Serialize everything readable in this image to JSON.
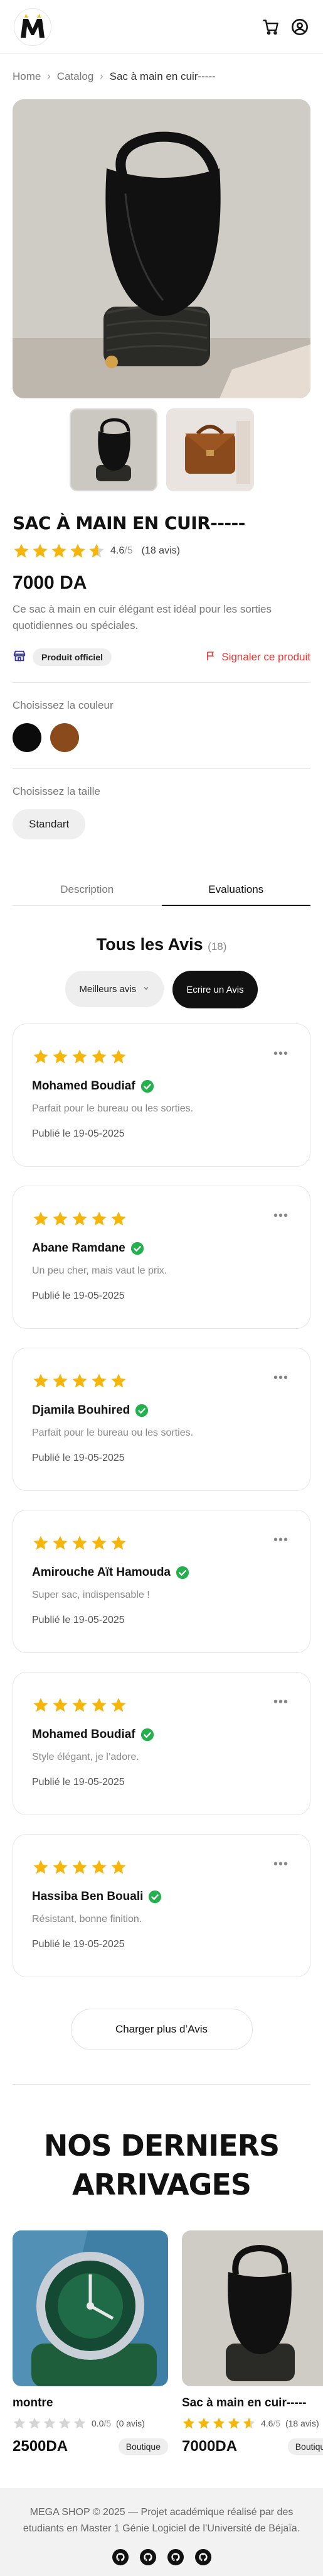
{
  "header": {
    "logo_letter": "M",
    "cart_icon": "cart-icon",
    "account_icon": "user-circle-icon"
  },
  "breadcrumb": {
    "items": [
      "Home",
      "Catalog",
      "Sac à main en cuir-----"
    ]
  },
  "product": {
    "title": "SAC À MAIN EN CUIR-----",
    "rating": "4.6",
    "rating_den": "/5",
    "rating_value": 4.6,
    "rating_count": "(18 avis)",
    "price": "7000 DA",
    "description": "Ce sac à main en cuir élégant est idéal pour les sorties quotidiennes ou spéciales.",
    "official_badge": "Produit officiel",
    "report_label": "Signaler ce produit",
    "color_label": "Choisissez la couleur",
    "colors": [
      "#0b0b0b",
      "#8a4a1c"
    ],
    "size_label": "Choisissez la taille",
    "sizes": [
      "Standart"
    ]
  },
  "tabs": [
    {
      "label": "Description",
      "active": false
    },
    {
      "label": "Evaluations",
      "active": true
    }
  ],
  "reviews": {
    "title": "Tous les Avis",
    "count": "(18)",
    "sort_label": "Meilleurs avis",
    "write_label": "Ecrire un Avis",
    "items": [
      {
        "stars": 5,
        "name": "Mohamed Boudiaf",
        "text": "Parfait pour le bureau ou les sorties.",
        "date": "Publié le 19-05-2025"
      },
      {
        "stars": 5,
        "name": "Abane Ramdane",
        "text": "Un peu cher, mais vaut le prix.",
        "date": "Publié le 19-05-2025"
      },
      {
        "stars": 5,
        "name": "Djamila Bouhired",
        "text": "Parfait pour le bureau ou les sorties.",
        "date": "Publié le 19-05-2025"
      },
      {
        "stars": 5,
        "name": "Amirouche Aït Hamouda",
        "text": "Super sac, indispensable !",
        "date": "Publié le 19-05-2025"
      },
      {
        "stars": 5,
        "name": "Mohamed Boudiaf",
        "text": "Style élégant, je l’adore.",
        "date": "Publié le 19-05-2025"
      },
      {
        "stars": 5,
        "name": "Hassiba Ben Bouali",
        "text": "Résistant, bonne finition.",
        "date": "Publié le 19-05-2025"
      }
    ],
    "load_more": "Charger plus d’Avis"
  },
  "arrivals": {
    "title_line1": "NOS DERNIERS",
    "title_line2": "ARRIVAGES",
    "products": [
      {
        "name": "montre",
        "rating": "0.0",
        "rating_den": "/5",
        "rating_value": 0,
        "count": "(0 avis)",
        "price": "2500DA",
        "badge": "Boutique"
      },
      {
        "name": "Sac à main en cuir-----",
        "rating": "4.6",
        "rating_den": "/5",
        "rating_value": 4.6,
        "count": "(18 avis)",
        "price": "7000DA",
        "badge": "Boutique"
      }
    ]
  },
  "footer": {
    "text": "MEGA SHOP © 2025 — Projet académique réalisé par des etudiants en Master 1 Génie Logiciel de l’Université de Béjaïa.",
    "icons": [
      "github-icon",
      "github-icon",
      "github-icon",
      "github-icon"
    ]
  },
  "colors": {
    "star": "#f5b50a",
    "star_empty": "#d4d4d4",
    "verified": "#22b14c",
    "report": "#e53935"
  }
}
